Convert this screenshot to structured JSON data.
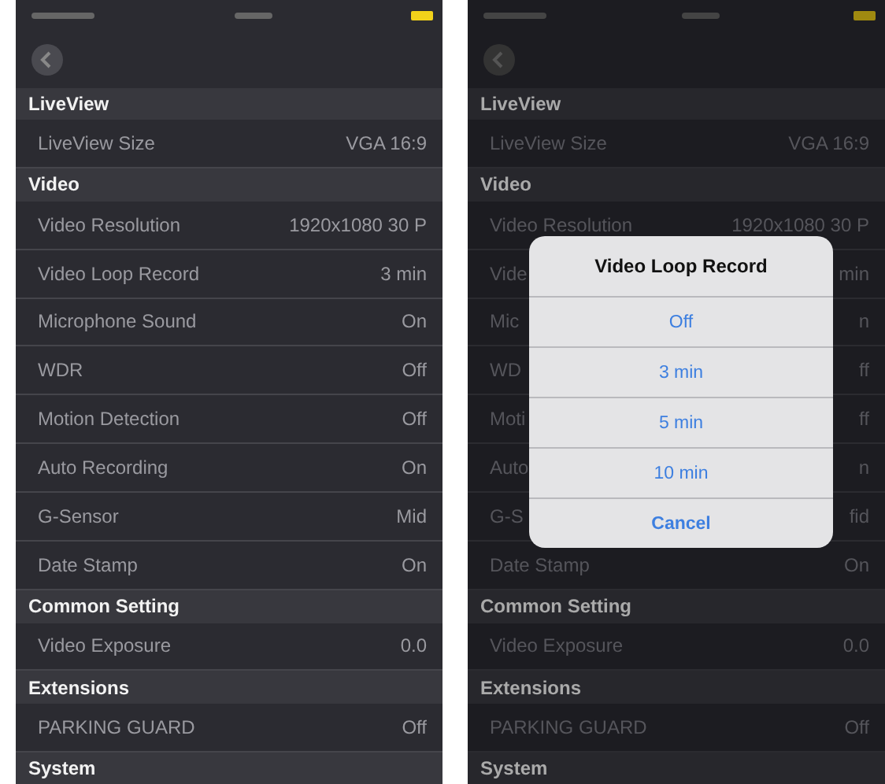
{
  "screens": [
    {
      "dimmed": false,
      "rows": [
        {
          "kind": "header",
          "label": "LiveView"
        },
        {
          "kind": "setting",
          "label": "LiveView Size",
          "value": "VGA 16:9"
        },
        {
          "kind": "header",
          "label": "Video"
        },
        {
          "kind": "setting",
          "label": "Video Resolution",
          "value": "1920x1080 30 P"
        },
        {
          "kind": "setting",
          "label": "Video Loop Record",
          "value": "3 min"
        },
        {
          "kind": "setting",
          "label": "Microphone Sound",
          "value": "On"
        },
        {
          "kind": "setting",
          "label": "WDR",
          "value": "Off"
        },
        {
          "kind": "setting",
          "label": "Motion Detection",
          "value": "Off"
        },
        {
          "kind": "setting",
          "label": "Auto Recording",
          "value": "On"
        },
        {
          "kind": "setting",
          "label": "G-Sensor",
          "value": "Mid"
        },
        {
          "kind": "setting",
          "label": "Date Stamp",
          "value": "On"
        },
        {
          "kind": "header",
          "label": "Common Setting"
        },
        {
          "kind": "setting",
          "label": "Video Exposure",
          "value": "0.0"
        },
        {
          "kind": "header",
          "label": "Extensions"
        },
        {
          "kind": "setting",
          "label": "PARKING GUARD",
          "value": "Off"
        },
        {
          "kind": "header",
          "label": "System"
        }
      ]
    },
    {
      "dimmed": true,
      "rows": [
        {
          "kind": "header",
          "label": "LiveView"
        },
        {
          "kind": "setting",
          "label": "LiveView Size",
          "value": "VGA 16:9"
        },
        {
          "kind": "header",
          "label": "Video"
        },
        {
          "kind": "setting",
          "label": "Video Resolution",
          "value": "1920x1080 30 P"
        },
        {
          "kind": "setting",
          "label": "Vide",
          "value": "min"
        },
        {
          "kind": "setting",
          "label": "Mic",
          "value": "n"
        },
        {
          "kind": "setting",
          "label": "WD",
          "value": "ff"
        },
        {
          "kind": "setting",
          "label": "Moti",
          "value": "ff"
        },
        {
          "kind": "setting",
          "label": "Auto",
          "value": "n"
        },
        {
          "kind": "setting",
          "label": "G-S",
          "value": "fid"
        },
        {
          "kind": "setting",
          "label": "Date Stamp",
          "value": "On"
        },
        {
          "kind": "header",
          "label": "Common Setting"
        },
        {
          "kind": "setting",
          "label": "Video Exposure",
          "value": "0.0"
        },
        {
          "kind": "header",
          "label": "Extensions"
        },
        {
          "kind": "setting",
          "label": "PARKING GUARD",
          "value": "Off"
        },
        {
          "kind": "header",
          "label": "System"
        }
      ],
      "dialog": {
        "title": "Video Loop Record",
        "options": [
          {
            "label": "Off",
            "kind": "option"
          },
          {
            "label": "3 min",
            "kind": "option"
          },
          {
            "label": "5 min",
            "kind": "option"
          },
          {
            "label": "10 min",
            "kind": "option"
          },
          {
            "label": "Cancel",
            "kind": "cancel"
          }
        ]
      }
    }
  ]
}
